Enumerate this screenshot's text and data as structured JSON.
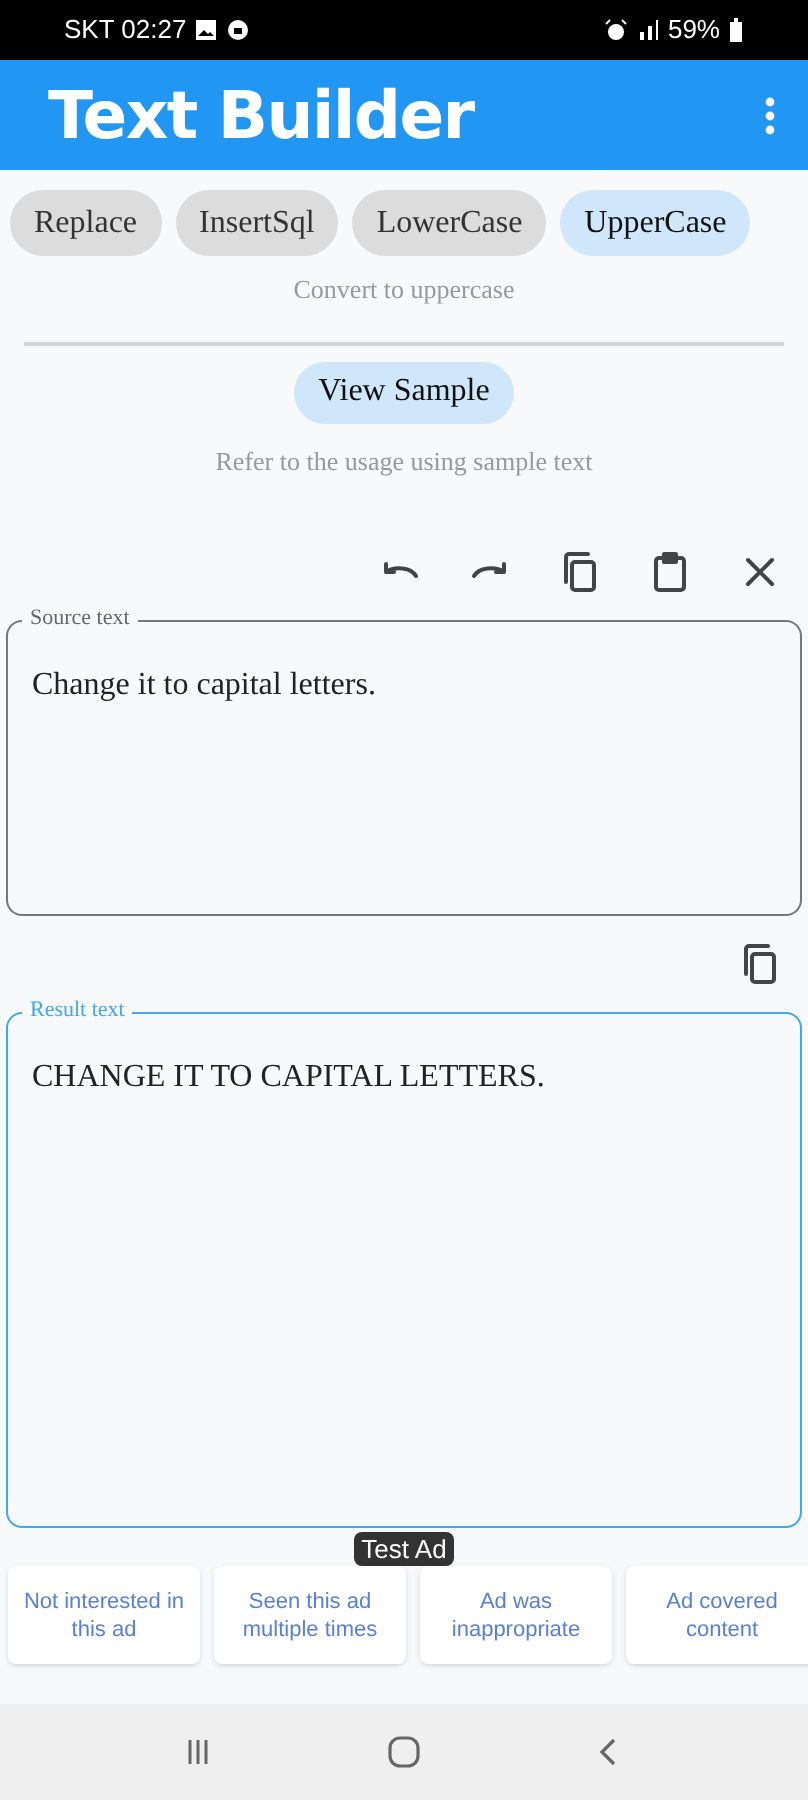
{
  "status_bar": {
    "carrier_time": "SKT 02:27",
    "battery": "59%"
  },
  "app_bar": {
    "title": "Text Builder"
  },
  "chips": [
    {
      "label": "Replace",
      "selected": false
    },
    {
      "label": "InsertSql",
      "selected": false
    },
    {
      "label": "LowerCase",
      "selected": false
    },
    {
      "label": "UpperCase",
      "selected": true
    }
  ],
  "chip_description": "Convert to uppercase",
  "sample_button": "View Sample",
  "sample_hint": "Refer to the usage using sample text",
  "source": {
    "label": "Source text",
    "value": "Change it to capital letters.",
    "focused": false
  },
  "result": {
    "label": "Result text",
    "value": "CHANGE IT TO CAPITAL LETTERS.",
    "focused": true
  },
  "ad": {
    "badge": "Test Ad",
    "options": [
      "Not interested in this ad",
      "Seen this ad multiple times",
      "Ad was inappropriate",
      "Ad covered content"
    ]
  }
}
